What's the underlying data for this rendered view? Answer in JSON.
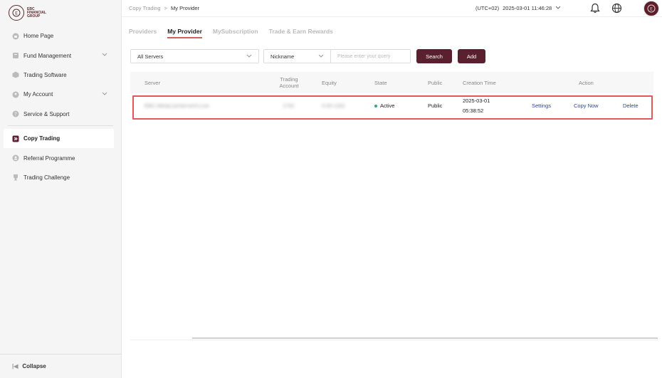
{
  "brand": {
    "line1": "EBC",
    "line2": "FINANCIAL",
    "line3": "GROUP"
  },
  "sidebar": {
    "items": [
      {
        "label": "Home Page",
        "icon": "home-icon",
        "has_chevron": false
      },
      {
        "label": "Fund Management",
        "icon": "wallet-icon",
        "has_chevron": true
      },
      {
        "label": "Trading Software",
        "icon": "box-icon",
        "has_chevron": false
      },
      {
        "label": "My Account",
        "icon": "user-icon",
        "has_chevron": true
      },
      {
        "label": "Service & Support",
        "icon": "help-icon",
        "has_chevron": false
      },
      {
        "label": "Copy Trading",
        "icon": "copy-trading-icon",
        "has_chevron": false,
        "active": true
      },
      {
        "label": "Referral Programme",
        "icon": "referral-icon",
        "has_chevron": false
      },
      {
        "label": "Trading Challenge",
        "icon": "trophy-icon",
        "has_chevron": false
      }
    ],
    "collapse_label": "Collapse"
  },
  "header": {
    "breadcrumb": [
      "Copy Trading",
      "My Provider"
    ],
    "breadcrumb_sep": ">",
    "timezone": "(UTC+02)",
    "datetime": "2025-03-01 11:46:28"
  },
  "tabs": [
    {
      "label": "Providers",
      "active": false
    },
    {
      "label": "My Provider",
      "active": true
    },
    {
      "label": "MySubscription",
      "active": false
    },
    {
      "label": "Trade & Earn Rewards",
      "active": false
    }
  ],
  "filters": {
    "server_select": "All Servers",
    "search_field": "Nickname",
    "search_placeholder": "Please enter your query",
    "search_button": "Search",
    "add_button": "Add"
  },
  "table": {
    "columns": [
      "Server",
      "Trading Account",
      "Equity",
      "State",
      "Public",
      "Creation Time",
      "Action"
    ],
    "rows": [
      {
        "server": "EBC-MetaLiveServer0-Live",
        "account": "1792",
        "equity": "0.00 USD",
        "state": "Active",
        "public": "Public",
        "creation_date": "2025-03-01",
        "creation_time": "05:38:52",
        "actions": [
          "Settings",
          "Copy Now",
          "Delete"
        ]
      }
    ]
  },
  "colors": {
    "accent": "#5a2030",
    "active_tab_underline": "#d06060",
    "status_active": "#3aa676",
    "link": "#2d4a8a",
    "highlight": "#e0595a"
  }
}
